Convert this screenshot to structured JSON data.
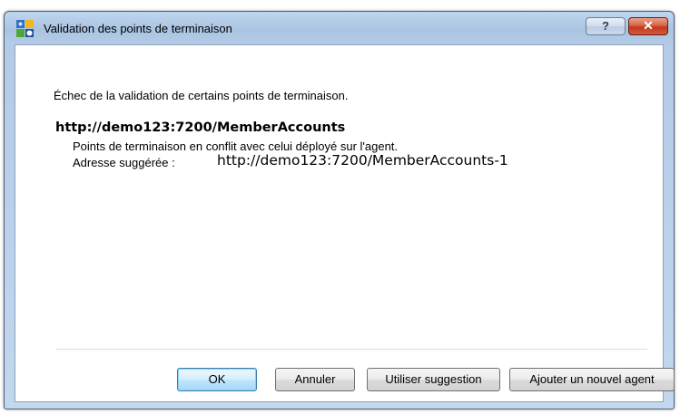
{
  "window": {
    "title": "Validation des points de terminaison"
  },
  "titlebar_buttons": {
    "help_label": "?",
    "close_label": "✕"
  },
  "content": {
    "message": "Échec de la validation de certains points de terminaison.",
    "endpoint_url": "http://demo123:7200/MemberAccounts",
    "conflict_text": "Points de terminaison en conflit avec celui déployé sur l'agent.",
    "suggested_label": "Adresse suggérée :",
    "suggested_value": "http://demo123:7200/MemberAccounts-1"
  },
  "buttons": {
    "ok": "OK",
    "cancel": "Annuler",
    "use_suggestion": "Utiliser suggestion",
    "add_agent": "Ajouter un nouvel agent"
  },
  "colors": {
    "titlebar": "#a9c4e2",
    "close_button": "#c23a1c",
    "default_button": "#bee6fd"
  }
}
